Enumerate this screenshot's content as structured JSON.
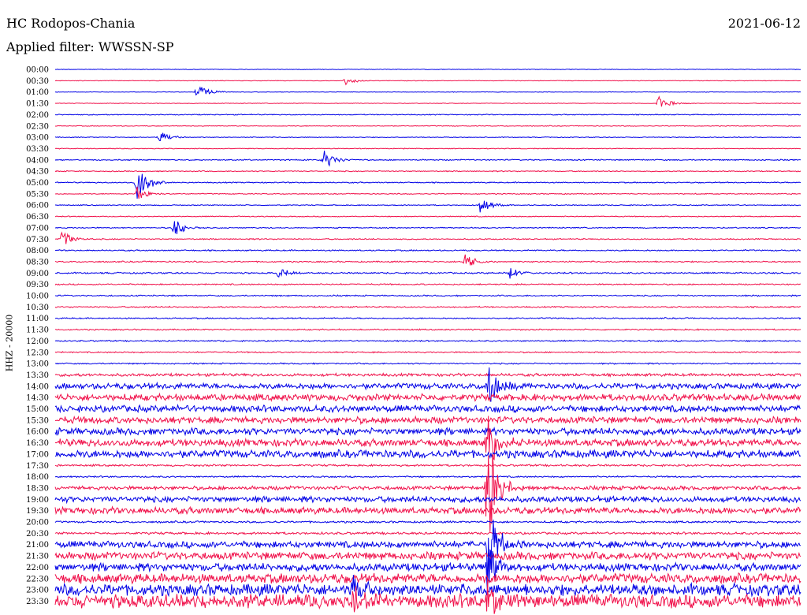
{
  "header": {
    "station": "HC Rodopos-Chania",
    "filter": "Applied filter: WWSSN-SP",
    "date": "2021-06-12"
  },
  "chart_data": {
    "type": "line",
    "title": "HC Rodopos-Chania",
    "subtitle": "Applied filter: WWSSN-SP",
    "date": "2021-06-12",
    "ylabel": "HHZ - 20000",
    "row_labels": [
      "00:00",
      "00:30",
      "01:00",
      "01:30",
      "02:00",
      "02:30",
      "03:00",
      "03:30",
      "04:00",
      "04:30",
      "05:00",
      "05:30",
      "06:00",
      "06:30",
      "07:00",
      "07:30",
      "08:00",
      "08:30",
      "09:00",
      "09:30",
      "10:00",
      "10:30",
      "11:00",
      "11:30",
      "12:00",
      "12:30",
      "13:00",
      "13:30",
      "14:00",
      "14:30",
      "15:00",
      "15:30",
      "16:00",
      "16:30",
      "17:00",
      "17:30",
      "18:00",
      "18:30",
      "19:00",
      "19:30",
      "20:00",
      "20:30",
      "21:00",
      "21:30",
      "22:00",
      "22:30",
      "23:00",
      "23:30"
    ],
    "colors": {
      "even": "#0000e6",
      "odd": "#f0104a"
    },
    "noise_levels": [
      0.3,
      0.3,
      0.3,
      0.3,
      0.5,
      0.4,
      0.4,
      0.4,
      0.6,
      0.5,
      0.6,
      0.5,
      0.5,
      0.5,
      0.6,
      0.6,
      0.7,
      0.7,
      0.8,
      0.7,
      0.7,
      0.7,
      0.7,
      0.7,
      0.7,
      0.7,
      0.7,
      1.5,
      3.0,
      3.5,
      3.5,
      3.5,
      3.5,
      3.8,
      4.0,
      1.0,
      0.8,
      2.0,
      3.0,
      3.5,
      1.0,
      1.2,
      3.5,
      4.0,
      4.0,
      5.0,
      6.0,
      7.0
    ],
    "events": [
      {
        "row": 1,
        "t": 0.39,
        "amp": 6
      },
      {
        "row": 2,
        "t": 0.19,
        "amp": 12
      },
      {
        "row": 3,
        "t": 0.81,
        "amp": 10
      },
      {
        "row": 6,
        "t": 0.14,
        "amp": 8
      },
      {
        "row": 8,
        "t": 0.36,
        "amp": 14
      },
      {
        "row": 10,
        "t": 0.11,
        "amp": 28
      },
      {
        "row": 11,
        "t": 0.11,
        "amp": 9
      },
      {
        "row": 12,
        "t": 0.57,
        "amp": 12
      },
      {
        "row": 14,
        "t": 0.16,
        "amp": 12
      },
      {
        "row": 15,
        "t": 0.01,
        "amp": 12
      },
      {
        "row": 17,
        "t": 0.55,
        "amp": 10
      },
      {
        "row": 18,
        "t": 0.3,
        "amp": 7
      },
      {
        "row": 18,
        "t": 0.61,
        "amp": 7
      },
      {
        "row": 28,
        "t": 0.58,
        "amp": 30
      },
      {
        "row": 33,
        "t": 0.58,
        "amp": 40
      },
      {
        "row": 37,
        "t": 0.58,
        "amp": 80
      },
      {
        "row": 42,
        "t": 0.58,
        "amp": 60
      },
      {
        "row": 44,
        "t": 0.58,
        "amp": 30
      },
      {
        "row": 46,
        "t": 0.4,
        "amp": 18
      },
      {
        "row": 47,
        "t": 0.4,
        "amp": 18
      },
      {
        "row": 47,
        "t": 0.58,
        "amp": 30
      }
    ]
  }
}
